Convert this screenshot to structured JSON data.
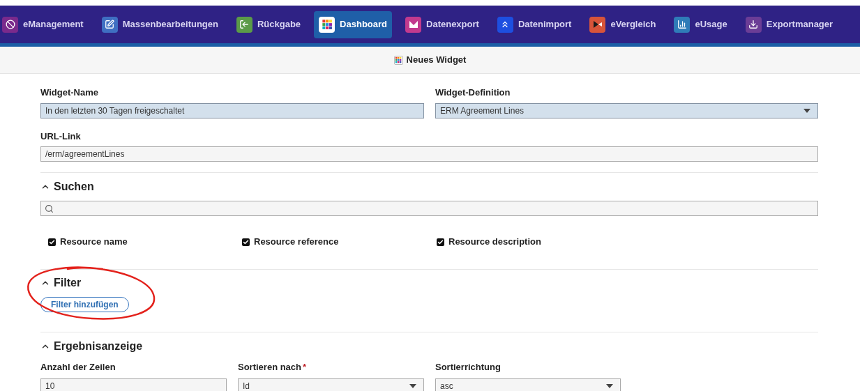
{
  "nav": {
    "items": [
      {
        "label": "eManagement",
        "color": "#7a2a8c",
        "selected": false
      },
      {
        "label": "Massenbearbeitungen",
        "color": "#3f6fc2",
        "selected": false
      },
      {
        "label": "Rückgabe",
        "color": "#5b9b48",
        "selected": false
      },
      {
        "label": "Dashboard",
        "color": "#ffffff",
        "selected": true
      },
      {
        "label": "Datenexport",
        "color": "#c23a8e",
        "selected": false
      },
      {
        "label": "Datenimport",
        "color": "#1d4fe0",
        "selected": false
      },
      {
        "label": "eVergleich",
        "color": "#d8543a",
        "selected": false
      },
      {
        "label": "eUsage",
        "color": "#2f7cb8",
        "selected": false
      },
      {
        "label": "Exportmanager",
        "color": "#6b3d96",
        "selected": false
      }
    ]
  },
  "header": {
    "title": "Neues Widget"
  },
  "widget_name": {
    "label": "Widget-Name",
    "value": "In den letzten 30 Tagen freigeschaltet"
  },
  "widget_definition": {
    "label": "Widget-Definition",
    "value": "ERM Agreement Lines"
  },
  "url_link": {
    "label": "URL-Link",
    "value": "/erm/agreementLines"
  },
  "search": {
    "title": "Suchen",
    "expanded": true,
    "fields": [
      {
        "label": "Resource name",
        "checked": true
      },
      {
        "label": "Resource reference",
        "checked": true
      },
      {
        "label": "Resource description",
        "checked": true
      }
    ]
  },
  "filter": {
    "title": "Filter",
    "expanded": true,
    "button": "Filter hinzufügen"
  },
  "results": {
    "title": "Ergebnisanzeige",
    "expanded": true,
    "fields": [
      {
        "kind": "input",
        "label": "Anzahl der Zeilen",
        "value": "10"
      },
      {
        "kind": "select",
        "label": "Sortieren nach",
        "required_mark": "*",
        "value": "Id"
      },
      {
        "kind": "select",
        "label": "Sortierrichtung",
        "value": "asc"
      }
    ]
  }
}
